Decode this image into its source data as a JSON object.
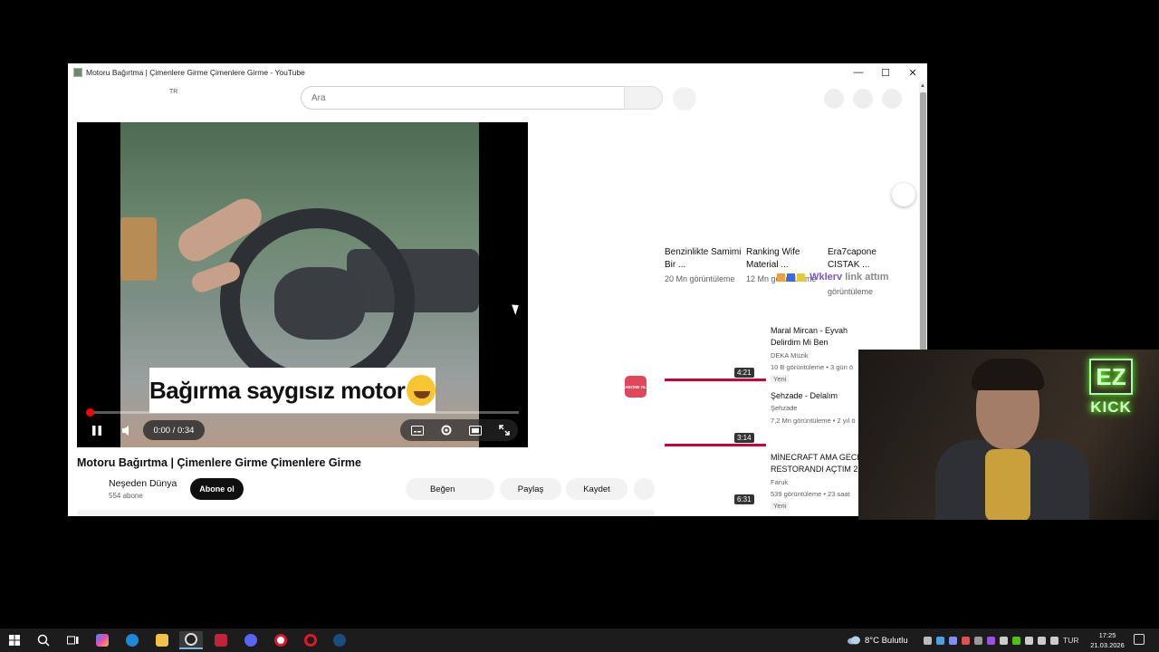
{
  "window": {
    "title": "Motoru Bağırtma | Çimenlere Girme Çimenlere Girme - YouTube",
    "controls": {
      "minimize": "—",
      "maximize": "☐",
      "close": "✕"
    }
  },
  "header": {
    "region": "TR",
    "search_placeholder": "Ara"
  },
  "player": {
    "caption": "Bağırma saygısız motor",
    "time": "0:00 / 0:34",
    "progress": 0.0
  },
  "video": {
    "title": "Motoru Bağırtma | Çimenlere Girme Çimenlere Girme",
    "channel": "Neşeden Dünya",
    "subscribers": "554 abone",
    "subscribe_label": "Abone ol",
    "like_label": "Beğen",
    "share_label": "Paylaş",
    "save_label": "Kaydet"
  },
  "abone_badge": "ABONE OL",
  "shorts": [
    {
      "title": "Benzinlikte Samimi Bir ...",
      "views": "20 Mn görüntüleme"
    },
    {
      "title": "Ranking Wife Material ...",
      "views": "12 Mn görüntüleme"
    },
    {
      "title": "Era7capone CISTAK ...",
      "views": "görüntüleme"
    }
  ],
  "recommendations": [
    {
      "title": "Maral Mircan - Eyvah Delirdim Mi Ben",
      "channel": "DEKA Müzik",
      "meta": "10 B görüntüleme • 3 gün ö",
      "badge": "Yeni",
      "duration": "4:21"
    },
    {
      "title": "Şehzade - Delalım",
      "channel": "Şehzade",
      "meta": "7,2 Mn görüntüleme • 2 yıl ö",
      "badge": "",
      "duration": "3:14"
    },
    {
      "title": "MİNECRAFT AMA GECE RESTORANDI AÇTIM 2",
      "channel": "Faruk",
      "meta": "539 görüntüleme • 23 saat",
      "badge": "Yeni",
      "duration": "6:31"
    }
  ],
  "overlay": {
    "name": "Wklerv",
    "link_text": "link attım"
  },
  "webcam": {
    "logo_top": "EZ",
    "logo_bottom": "KICK"
  },
  "taskbar": {
    "weather": "8°C  Bulutlu",
    "lang": "TUR",
    "time": "17:25",
    "date": "21.03.2026"
  }
}
